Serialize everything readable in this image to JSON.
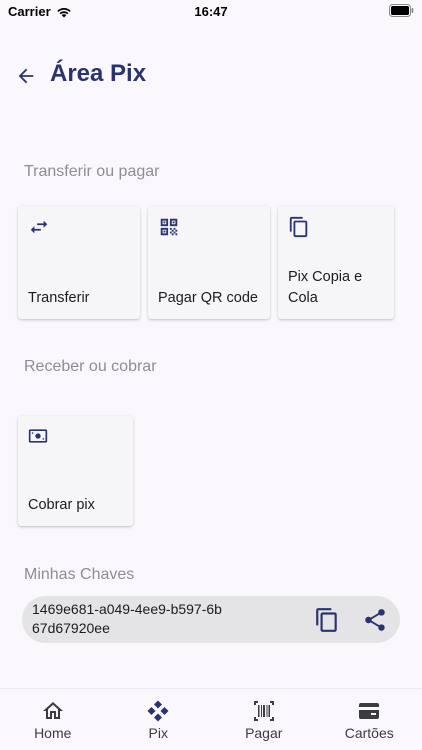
{
  "status": {
    "carrier": "Carrier",
    "time": "16:47"
  },
  "header": {
    "title": "Área Pix"
  },
  "transfer_section": {
    "title": "Transferir ou pagar",
    "cards": [
      {
        "label": "Transferir",
        "icon": "transfer-arrows-icon"
      },
      {
        "label": "Pagar QR code",
        "icon": "qr-code-icon"
      },
      {
        "label": "Pix Copia e Cola",
        "icon": "copy-icon"
      }
    ]
  },
  "receive_section": {
    "title": "Receber ou cobrar",
    "cards": [
      {
        "label": "Cobrar pix",
        "icon": "money-icon"
      }
    ]
  },
  "keys_section": {
    "title": "Minhas Chaves",
    "key_value": "1469e681-a049-4ee9-b597-6b67d67920ee"
  },
  "bottom_nav": {
    "items": [
      {
        "label": "Home",
        "icon": "home-icon"
      },
      {
        "label": "Pix",
        "icon": "pix-icon"
      },
      {
        "label": "Pagar",
        "icon": "barcode-icon"
      },
      {
        "label": "Cartões",
        "icon": "card-icon"
      }
    ]
  },
  "colors": {
    "title": "#2a3370",
    "accent": "#2a3370",
    "background": "#fbf8fd"
  }
}
